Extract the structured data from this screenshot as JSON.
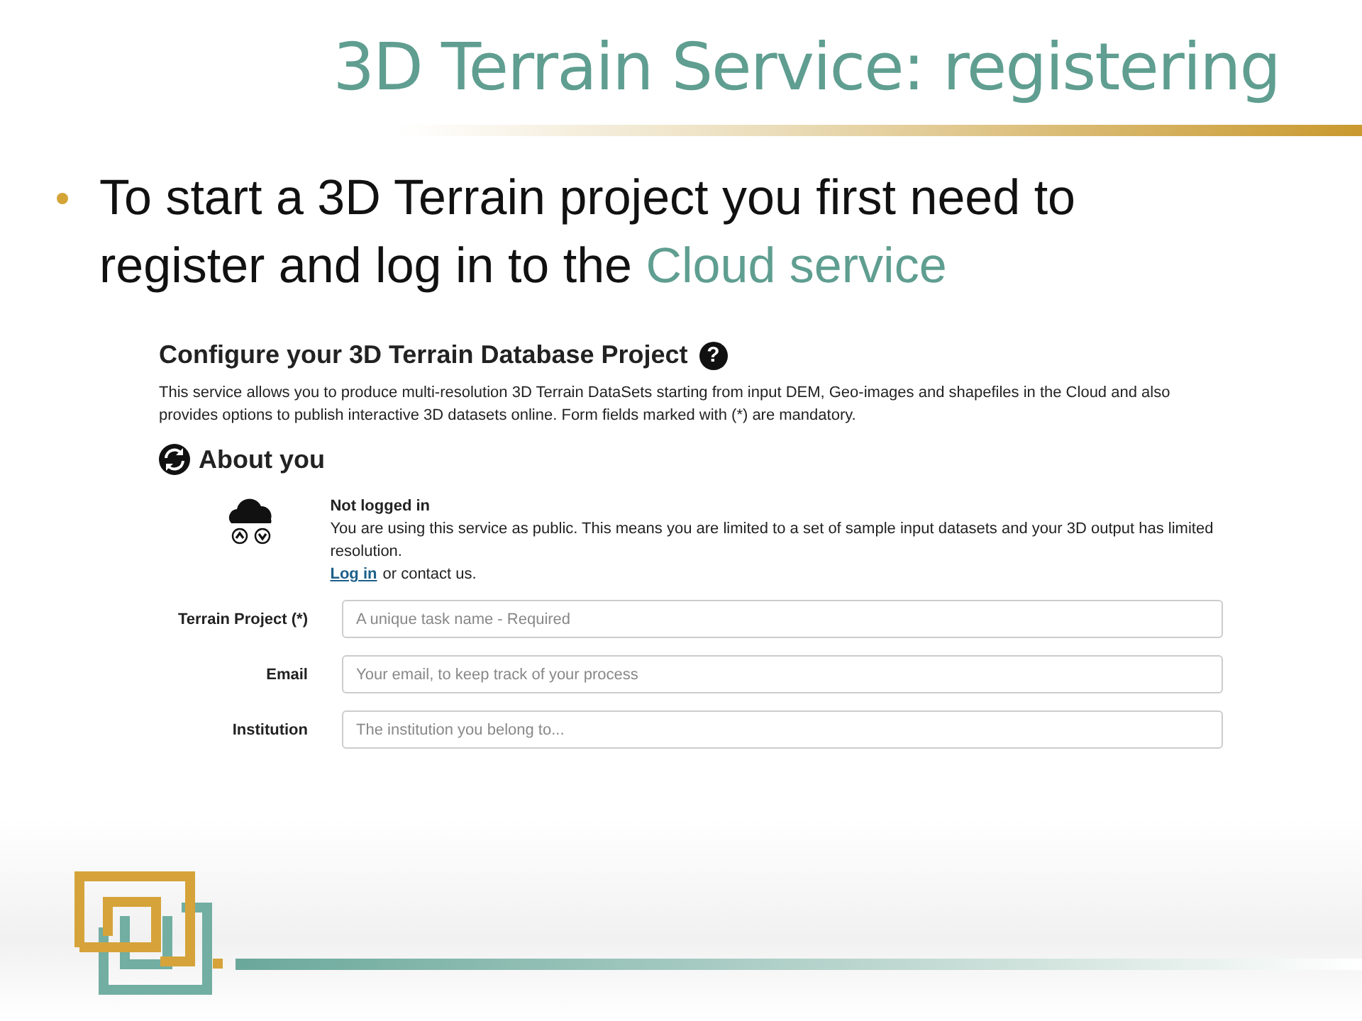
{
  "slide": {
    "title": "3D Terrain Service: registering",
    "bullets": [
      {
        "text": "To start a 3D Terrain project you first need to register and log in to the ",
        "link": "Cloud service"
      }
    ]
  },
  "form": {
    "heading": "Configure your 3D Terrain Database Project",
    "help": "?",
    "intro": "This service allows you to produce multi-resolution 3D Terrain DataSets starting from input DEM, Geo-images and shapefiles in the Cloud and also provides options to publish interactive 3D datasets online. Form fields marked with (*) are mandatory.",
    "section": "About you",
    "status": {
      "title": "Not logged in",
      "message": "You are using this service as public. This means you are limited to a set of sample input datasets and your 3D output has limited resolution.",
      "login_link": "Log in",
      "login_suffix": "or contact us."
    },
    "fields": [
      {
        "label": "Terrain Project (*)",
        "placeholder": "A unique task name - Required"
      },
      {
        "label": "Email",
        "placeholder": "Your email, to keep track of your process"
      },
      {
        "label": "Institution",
        "placeholder": "The institution you belong to..."
      }
    ]
  }
}
